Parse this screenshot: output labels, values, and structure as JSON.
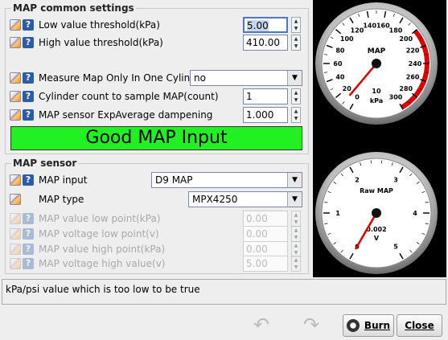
{
  "common": {
    "title": "MAP common settings",
    "low_label": "Low value threshold(kPa)",
    "low_value": "5.00",
    "high_label": "High value threshold(kPa)",
    "high_value": "410.00",
    "measure_label": "Measure Map Only In One Cylinder",
    "measure_value": "no",
    "cyl_label": "Cylinder count to sample MAP(count)",
    "cyl_value": "1",
    "exp_label": "MAP sensor ExpAverage dampening",
    "exp_value": "1.000",
    "status_banner": "Good MAP Input"
  },
  "sensor": {
    "title": "MAP sensor",
    "input_label": "MAP input",
    "input_value": "D9 MAP",
    "type_label": "MAP type",
    "type_value": "MPX4250",
    "low_point_label": "MAP value low point(kPa)",
    "low_point_value": "0.00",
    "volt_low_label": "MAP voltage low point(v)",
    "volt_low_value": "0.00",
    "high_point_label": "MAP value high point(kPa)",
    "high_point_value": "0.00",
    "volt_high_label": "MAP voltage high value(v)",
    "volt_high_value": "5.00"
  },
  "gauge_map": {
    "title": "MAP",
    "value": "10",
    "unit": "kPa",
    "ticks": [
      "0",
      "20",
      "40",
      "60",
      "80",
      "100",
      "120",
      "140",
      "160",
      "180",
      "200",
      "220",
      "240",
      "260",
      "280",
      "300"
    ],
    "redline_color": "#e00000"
  },
  "gauge_raw": {
    "title": "Raw MAP",
    "value": "0.002",
    "unit": "V",
    "ticks": [
      "0",
      "1",
      "2",
      "3",
      "4",
      "5"
    ]
  },
  "status_text": "kPa/psi value which is too low to be true",
  "buttons": {
    "burn": "Burn",
    "close": "Close"
  },
  "icons": {
    "help": "?",
    "spin_up": "▲",
    "spin_down": "▼",
    "combo_arrow": "▼"
  }
}
